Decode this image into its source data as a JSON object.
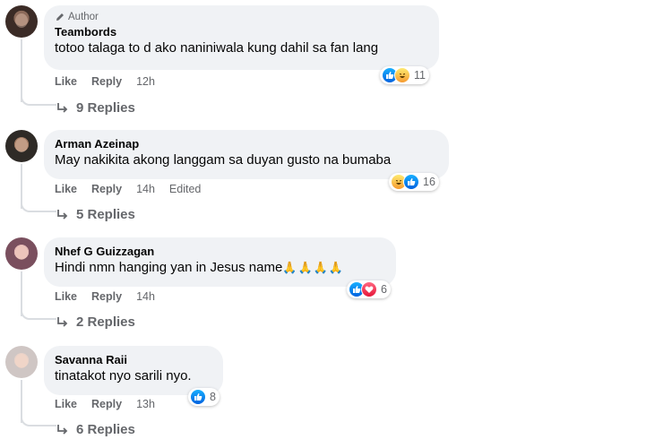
{
  "comments": [
    {
      "author_badge": "Author",
      "name": "Teambords",
      "text": "totoo talaga to d ako naniniwala kung dahil sa fan lang",
      "reactions": [
        "like",
        "haha"
      ],
      "reaction_count": "11",
      "actions": {
        "like": "Like",
        "reply": "Reply",
        "time": "12h",
        "edited": ""
      },
      "replies": "9 Replies"
    },
    {
      "author_badge": "",
      "name": "Arman Azeinap",
      "text": "May nakikita akong langgam sa duyan gusto na bumaba",
      "reactions": [
        "haha",
        "like"
      ],
      "reaction_count": "16",
      "actions": {
        "like": "Like",
        "reply": "Reply",
        "time": "14h",
        "edited": "Edited"
      },
      "replies": "5 Replies"
    },
    {
      "author_badge": "",
      "name": "Nhef G Guizzagan",
      "text": "Hindi nmn hanging yan in Jesus name",
      "text_suffix": "🙏🙏🙏🙏",
      "reactions": [
        "like",
        "love"
      ],
      "reaction_count": "6",
      "actions": {
        "like": "Like",
        "reply": "Reply",
        "time": "14h",
        "edited": ""
      },
      "replies": "2 Replies"
    },
    {
      "author_badge": "",
      "name": "Savanna Raii",
      "text": "tinatakot nyo sarili nyo.",
      "reactions": [
        "like"
      ],
      "reaction_count": "8",
      "actions": {
        "like": "Like",
        "reply": "Reply",
        "time": "13h",
        "edited": ""
      },
      "replies": "6 Replies"
    }
  ],
  "colors": {
    "like": "#1877f2",
    "love": "#e61739",
    "haha": "#f7b928",
    "bubble": "#f0f2f5",
    "muted": "#65676b"
  }
}
